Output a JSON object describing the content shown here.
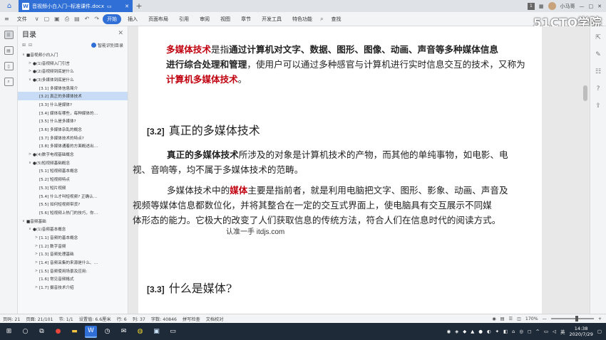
{
  "titlebar": {
    "doc_tab": "音视频小白入门--标准课件.docx",
    "badge": "1",
    "user": "小马哥",
    "window_controls": [
      "—",
      "□",
      "✕"
    ]
  },
  "menubar": {
    "file_menu": "文件",
    "items": [
      "开始",
      "插入",
      "页面布局",
      "引用",
      "审阅",
      "视图",
      "章节",
      "开发工具",
      "特色功能"
    ],
    "active": "开始",
    "search": "查找",
    "watermark_logo": "51CTO学院"
  },
  "nav": {
    "title": "目录",
    "smart_label": "智能识别目录",
    "items": [
      {
        "text": "■音视频小白入门",
        "arrow": "∨",
        "indent": 0,
        "selected": false
      },
      {
        "text": "●(1)音视频入门引言",
        "arrow": ">",
        "indent": 1,
        "selected": false
      },
      {
        "text": "●(2)音视频到底是什么",
        "arrow": ">",
        "indent": 1,
        "selected": false
      },
      {
        "text": "●(3)多媒体到底是什么",
        "arrow": "∨",
        "indent": 1,
        "selected": false
      },
      {
        "text": "[3.1]  多媒体信息简介",
        "arrow": "",
        "indent": 2,
        "selected": false
      },
      {
        "text": "[3.2]  真正的多媒体技术",
        "arrow": "",
        "indent": 2,
        "selected": true
      },
      {
        "text": "[3.3]  什么是媒体?",
        "arrow": "",
        "indent": 2,
        "selected": false
      },
      {
        "text": "[3.4]  媒体有哪些，每种媒体的…",
        "arrow": "",
        "indent": 2,
        "selected": false
      },
      {
        "text": "[3.5]  什么是多媒体?",
        "arrow": "",
        "indent": 2,
        "selected": false
      },
      {
        "text": "[3.6]  多媒体杂乱的概念",
        "arrow": "",
        "indent": 2,
        "selected": false
      },
      {
        "text": "[3.7]  多媒体技术的特点?",
        "arrow": "",
        "indent": 2,
        "selected": false
      },
      {
        "text": "[3.8]  多媒体通着的方面概述出…",
        "arrow": "",
        "indent": 2,
        "selected": false
      },
      {
        "text": "●(4)数字电视基础概念",
        "arrow": ">",
        "indent": 1,
        "selected": false
      },
      {
        "text": "●(5)短视频基础概念",
        "arrow": "∨",
        "indent": 1,
        "selected": false
      },
      {
        "text": "[5.1]  短视频基本概念",
        "arrow": "",
        "indent": 2,
        "selected": false
      },
      {
        "text": "[5.2]  短视频特点",
        "arrow": "",
        "indent": 2,
        "selected": false
      },
      {
        "text": "[5.3]  短片视频",
        "arrow": "",
        "indent": 2,
        "selected": false
      },
      {
        "text": "[5.4]  什么才叫短视频? 正确认…",
        "arrow": "",
        "indent": 2,
        "selected": false
      },
      {
        "text": "[5.5]  如何短视频带货?",
        "arrow": "",
        "indent": 2,
        "selected": false
      },
      {
        "text": "[5.6]  短视频上热门的技巧，你…",
        "arrow": "",
        "indent": 2,
        "selected": false
      },
      {
        "text": "■音频基础",
        "arrow": "∨",
        "indent": 0,
        "selected": false
      },
      {
        "text": "●(1)音频基本概念",
        "arrow": "∨",
        "indent": 1,
        "selected": false
      },
      {
        "text": "[1.1]  音频的基本概念",
        "arrow": ">",
        "indent": 2,
        "selected": false
      },
      {
        "text": "[1.2]  数字音频",
        "arrow": ">",
        "indent": 2,
        "selected": false
      },
      {
        "text": "[1.3]  音频处理基础",
        "arrow": ">",
        "indent": 2,
        "selected": false
      },
      {
        "text": "[1.4]  音频采集的来源是什么、…",
        "arrow": ">",
        "indent": 2,
        "selected": false
      },
      {
        "text": "[1.5]  音频使用场景及应用:",
        "arrow": ">",
        "indent": 2,
        "selected": false
      },
      {
        "text": "[1.6]  常见音频格式",
        "arrow": "",
        "indent": 2,
        "selected": false
      },
      {
        "text": "[1.7]  摄音技术介绍",
        "arrow": ">",
        "indent": 2,
        "selected": false
      }
    ]
  },
  "doc": {
    "para1_a": "多媒体技术",
    "para1_b": "是指",
    "para1_c": "通过计算机对文字、数据、图形、图像、动画、声音等多种媒体信息",
    "para1_d": "进行综合处理和管理",
    "para1_e": "，使用户可以通过多种感官与计算机进行实时信息交互的技术，又称为",
    "para1_f": "计算机多媒体技术",
    "para1_g": "。",
    "h32_num": "[3.2]",
    "h32_text": "真正的多媒体技术",
    "para2_a": "真正的多媒体技术",
    "para2_b": "所涉及的对象是计算机技术的产物，而其他的单纯事物，如电影、电",
    "para2_c": "视、音响等，均不属于多媒体技术的范畴。",
    "para3_a": "多媒体技术中的",
    "para3_b": "媒体",
    "para3_c": "主要是指前者，就是利用电脑把文字、图形、影象、动画、声音及",
    "para3_d": "视频等媒体信息都数位化，并将其整合在一定的交互式界面上，使电脑具有交互展示不同媒",
    "para3_e": "体形态的能力。它极大的改变了人们获取信息的传统方法，符合人们在信息时代的阅读方式。",
    "watermark": "认准一手 itdjs.com",
    "h33_num": "[3.3]",
    "h33_text": "什么是媒体?"
  },
  "status": {
    "page": "页码: 21",
    "pages": "页面: 21/101",
    "section": "节: 1/1",
    "setting": "设置值: 6.6厘米",
    "row": "行: 6",
    "col": "列: 37",
    "words": "字数: 40846",
    "spell": "拼写检查",
    "proof": "文档校对",
    "zoom": "170%",
    "zoom_minus": "—",
    "zoom_plus": "+"
  },
  "taskbar": {
    "time": "14:38",
    "date": "2020/7/29",
    "lang": "英",
    "tray_text": "^ 英"
  }
}
